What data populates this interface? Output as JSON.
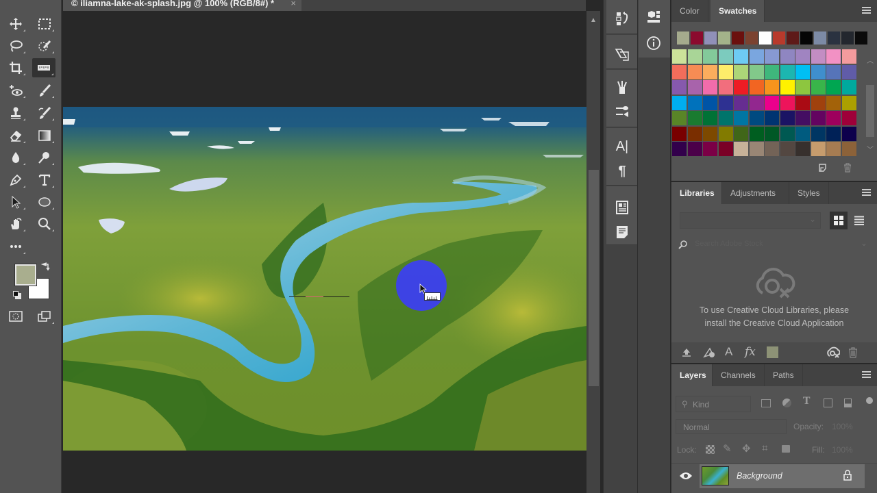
{
  "document": {
    "tab_title": "© iliamna-lake-ak-splash.jpg @ 100% (RGB/8#) *",
    "close": "×"
  },
  "toolbar": {
    "tools": [
      {
        "name": "move-tool",
        "glyph": "✥"
      },
      {
        "name": "rectangular-marquee-tool",
        "glyph": "⬚"
      },
      {
        "name": "lasso-tool",
        "glyph": "ᘓ"
      },
      {
        "name": "quick-selection-tool",
        "glyph": "⦚"
      },
      {
        "name": "crop-tool",
        "glyph": "⌗"
      },
      {
        "name": "ruler-tool",
        "glyph": "▭"
      },
      {
        "name": "spot-healing-tool",
        "glyph": "⁺◉"
      },
      {
        "name": "brush-tool",
        "glyph": "✎"
      },
      {
        "name": "clone-stamp-tool",
        "glyph": "⚲"
      },
      {
        "name": "history-brush-tool",
        "glyph": "✐"
      },
      {
        "name": "eraser-tool",
        "glyph": "⌫"
      },
      {
        "name": "gradient-tool",
        "glyph": "■"
      },
      {
        "name": "blur-tool",
        "glyph": "💧"
      },
      {
        "name": "dodge-tool",
        "glyph": "⚲"
      },
      {
        "name": "pen-tool",
        "glyph": "✒"
      },
      {
        "name": "type-tool",
        "glyph": "T"
      },
      {
        "name": "path-selection-tool",
        "glyph": "➤"
      },
      {
        "name": "ellipse-tool",
        "glyph": "◯"
      },
      {
        "name": "hand-tool",
        "glyph": "✋"
      },
      {
        "name": "zoom-tool",
        "glyph": "🔍"
      },
      {
        "name": "more-tools",
        "glyph": "•••"
      }
    ],
    "foreground_color": "#a9ae8e",
    "background_color": "#ffffff"
  },
  "swatches_panel": {
    "tabs": [
      "Color",
      "Swatches"
    ],
    "active_tab": "Swatches",
    "recent": [
      "#a5ab8d",
      "#8b0a2e",
      "#9090b8",
      "#a3b38a",
      "#6b100e",
      "#7b4230",
      "#ffffff",
      "#b83a2c",
      "#5e1a18",
      "#050505",
      "#7c8aa5",
      "#2a3240",
      "#23272e",
      "#0a0a0a"
    ],
    "grid": [
      [
        "#cce29a",
        "#a9d597",
        "#83c99a",
        "#7ccbbe",
        "#6ecbf3",
        "#7aa6df",
        "#8799d2",
        "#8f86c1",
        "#a084c1",
        "#c38dc3",
        "#f291c4",
        "#f49b9d"
      ],
      [
        "#f26d5b",
        "#f68c54",
        "#fbad5d",
        "#fded6a",
        "#add578",
        "#82c98a",
        "#3fb77c",
        "#1cb6b0",
        "#00bff3",
        "#3f8fcd",
        "#5674b9",
        "#605ca8"
      ],
      [
        "#8659ad",
        "#a863ab",
        "#f26cab",
        "#f26e7d",
        "#ed1c24",
        "#f26522",
        "#f7941d",
        "#fff200",
        "#8dc63f",
        "#39b54a",
        "#00a651",
        "#00a99d"
      ],
      [
        "#00aeef",
        "#0072bc",
        "#0054a6",
        "#2e3192",
        "#662d91",
        "#92278f",
        "#ec008c",
        "#ed145b",
        "#aa0b14",
        "#a0410d",
        "#a36209",
        "#aba000"
      ],
      [
        "#598527",
        "#1a7b30",
        "#007236",
        "#00746b",
        "#0076a3",
        "#004a80",
        "#003471",
        "#1b1464",
        "#440e62",
        "#630460",
        "#9e005d",
        "#9e0039"
      ],
      [
        "#790000",
        "#7a2e00",
        "#7d4900",
        "#827b00",
        "#406618",
        "#005e20",
        "#005826",
        "#005952",
        "#005b7f",
        "#003663",
        "#002157",
        "#0d004c"
      ],
      [
        "#32004b",
        "#4b0049",
        "#7b0046",
        "#7a0026",
        "#c7b299",
        "#998675",
        "#736357",
        "#534741",
        "#37302d",
        "#c69c6d",
        "#a67c52",
        "#8c6239"
      ]
    ]
  },
  "libraries_panel": {
    "tabs": [
      "Libraries",
      "Adjustments",
      "Styles"
    ],
    "active_tab": "Libraries",
    "search_placeholder": "Search Adobe Stock",
    "message": "To use Creative Cloud Libraries, please install the Creative Cloud Application",
    "footer_icons": [
      "upload-icon",
      "add-graphic-icon",
      "add-character-style-icon",
      "add-layer-style-icon",
      "add-color-icon",
      "cloud-status-icon",
      "trash-icon"
    ],
    "color_chip": "#8d9276"
  },
  "layers_panel": {
    "tabs": [
      "Layers",
      "Channels",
      "Paths"
    ],
    "active_tab": "Layers",
    "filter_label": "Kind",
    "blend_mode": "Normal",
    "opacity_label": "Opacity:",
    "opacity_value": "100%",
    "lock_label": "Lock:",
    "fill_label": "Fill:",
    "fill_value": "100%",
    "layers": [
      {
        "name": "Background",
        "visible": true,
        "locked": true
      }
    ]
  },
  "overlay": {
    "cursor_circle_color": "#3b3bff",
    "ruler_line_color": "#1a1a1a",
    "ruler_highlight_color": "#e0607a"
  }
}
